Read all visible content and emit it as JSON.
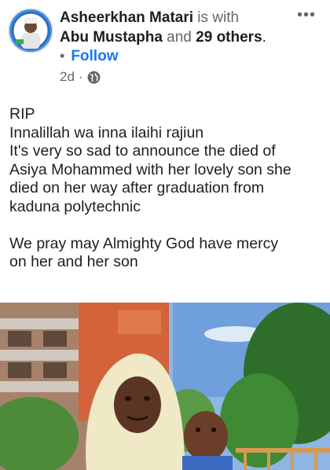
{
  "post": {
    "author": "Asheerkhan Matari",
    "with_text": " is with",
    "tagged": "Abu Mustapha",
    "and_text": " and ",
    "others": "29 others",
    "period": ".",
    "follow_label": "Follow",
    "time": "2d",
    "meta_sep": "·",
    "privacy_icon": "globe-icon",
    "more_label": "•••",
    "lines": [
      "RIP",
      "Innalillah wa inna ilaihi rajiun",
      "It's very so sad to announce the died of",
      "Asiya Mohammed with her lovely son she",
      "died on her way after graduation from",
      "kaduna polytechnic",
      "We pray may Almighty God have mercy",
      "on her and her son"
    ]
  },
  "colors": {
    "link": "#1877f2",
    "muted": "#65676b",
    "text": "#1c1e21"
  }
}
